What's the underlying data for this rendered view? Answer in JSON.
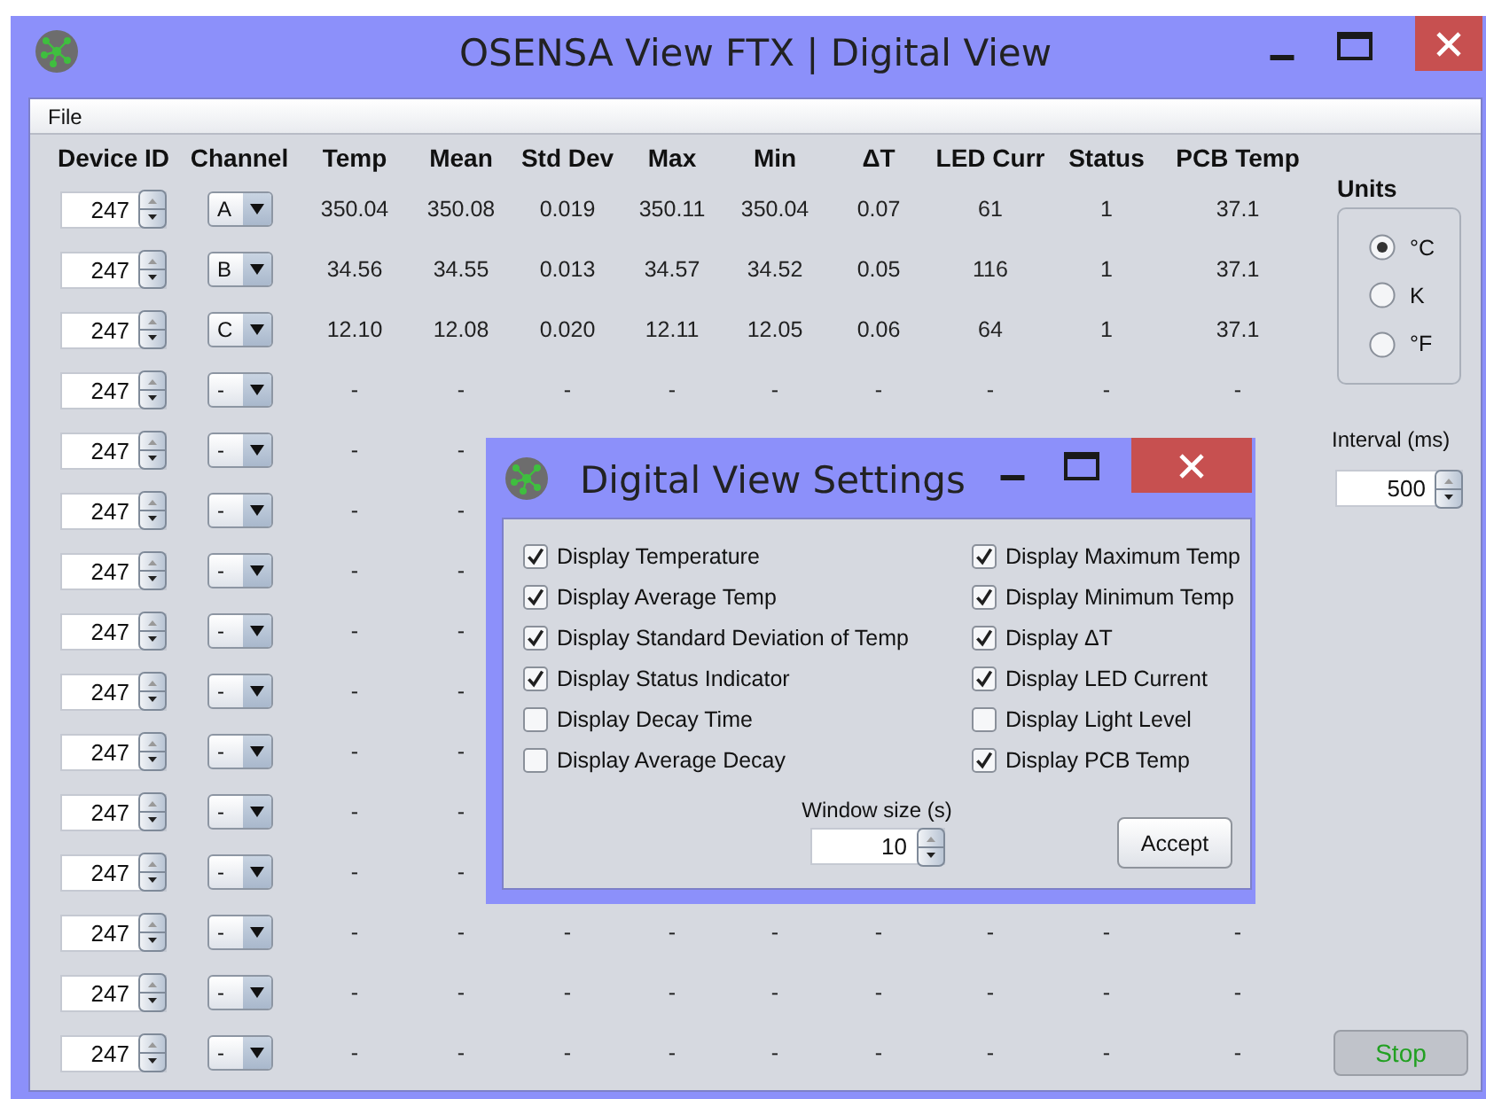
{
  "window": {
    "title": "OSENSA View FTX | Digital View"
  },
  "menu": [
    {
      "label": "File"
    }
  ],
  "table": {
    "columns": [
      "Device ID",
      "Channel",
      "Temp",
      "Mean",
      "Std Dev",
      "Max",
      "Min",
      "ΔT",
      "LED Curr",
      "Status",
      "PCB Temp"
    ],
    "rows": [
      {
        "cells": [
          "247",
          "A",
          "350.04",
          "350.08",
          "0.019",
          "350.11",
          "350.04",
          "0.07",
          "61",
          "1",
          "37.1"
        ]
      },
      {
        "cells": [
          "247",
          "B",
          "34.56",
          "34.55",
          "0.013",
          "34.57",
          "34.52",
          "0.05",
          "116",
          "1",
          "37.1"
        ]
      },
      {
        "cells": [
          "247",
          "C",
          "12.10",
          "12.08",
          "0.020",
          "12.11",
          "12.05",
          "0.06",
          "64",
          "1",
          "37.1"
        ]
      },
      {
        "cells": [
          "247",
          "-",
          "-",
          "-",
          "-",
          "-",
          "-",
          "-",
          "-",
          "-",
          "-"
        ]
      },
      {
        "cells": [
          "247",
          "-",
          "-",
          "-"
        ]
      },
      {
        "cells": [
          "247",
          "-",
          "-",
          "-"
        ]
      },
      {
        "cells": [
          "247",
          "-",
          "-",
          "-"
        ]
      },
      {
        "cells": [
          "247",
          "-",
          "-",
          "-"
        ]
      },
      {
        "cells": [
          "247",
          "-",
          "-",
          "-"
        ]
      },
      {
        "cells": [
          "247",
          "-",
          "-",
          "-"
        ]
      },
      {
        "cells": [
          "247",
          "-",
          "-",
          "-"
        ]
      },
      {
        "cells": [
          "247",
          "-",
          "-",
          "-"
        ]
      },
      {
        "cells": [
          "247",
          "-",
          "-",
          "-",
          "-",
          "-",
          "-",
          "-",
          "-",
          "-",
          "-"
        ]
      },
      {
        "cells": [
          "247",
          "-",
          "-",
          "-",
          "-",
          "-",
          "-",
          "-",
          "-",
          "-",
          "-"
        ]
      },
      {
        "cells": [
          "247",
          "-",
          "-",
          "-",
          "-",
          "-",
          "-",
          "-",
          "-",
          "-",
          "-"
        ]
      }
    ]
  },
  "units": {
    "title": "Units",
    "options": [
      {
        "label": "°C",
        "selected": true
      },
      {
        "label": "K",
        "selected": false
      },
      {
        "label": "°F",
        "selected": false
      }
    ]
  },
  "interval": {
    "label": "Interval (ms)",
    "value": "500"
  },
  "stop_button": "Stop",
  "dialog": {
    "title": "Digital View Settings",
    "options": [
      {
        "label": "Display Temperature",
        "checked": true
      },
      {
        "label": "Display Average Temp",
        "checked": true
      },
      {
        "label": "Display Standard Deviation of Temp",
        "checked": true
      },
      {
        "label": "Display Status Indicator",
        "checked": true
      },
      {
        "label": "Display Decay Time",
        "checked": false
      },
      {
        "label": "Display Average Decay",
        "checked": false
      },
      {
        "label": "Display Maximum Temp",
        "checked": true
      },
      {
        "label": "Display Minimum Temp",
        "checked": true
      },
      {
        "label": "Display ΔT",
        "checked": true
      },
      {
        "label": "Display LED Current",
        "checked": true
      },
      {
        "label": "Display Light Level",
        "checked": false
      },
      {
        "label": "Display PCB Temp",
        "checked": true
      }
    ],
    "window_size": {
      "label": "Window size (s)",
      "value": "10"
    },
    "accept_button": "Accept"
  }
}
